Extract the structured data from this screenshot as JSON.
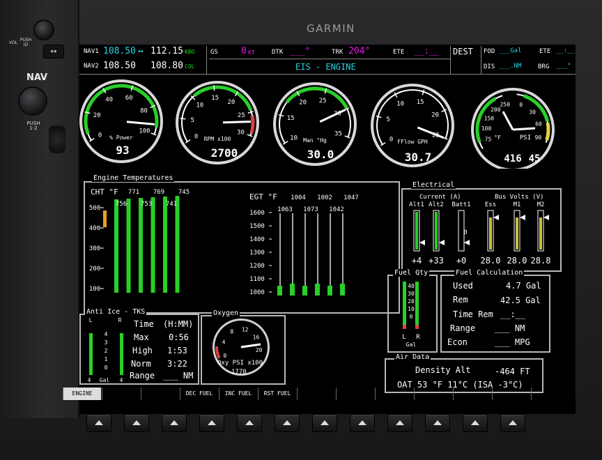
{
  "brand": "GARMIN",
  "bezel": {
    "vol_label": "VOL",
    "push_id_label": "PUSH\nID",
    "nav_label": "NAV",
    "push12_label": "PUSH\n1-2",
    "swap_icon": "swap-arrows-icon"
  },
  "nav": {
    "nav1_label": "NAV1",
    "nav1_active": "108.50",
    "nav1_standby": "112.15",
    "nav1_ident": "KBO",
    "nav2_label": "NAV2",
    "nav2_active": "108.50",
    "nav2_standby": "108.80",
    "nav2_ident": "COL"
  },
  "top": {
    "gs_label": "GS",
    "gs_value": "0",
    "gs_unit": "KT",
    "dtk_label": "DTK",
    "dtk_value": "___°",
    "trk_label": "TRK",
    "trk_value": "204°",
    "ete_label": "ETE",
    "ete_value": "__:__",
    "dest_label": "DEST",
    "fod_label": "FOD",
    "fod_value": "___Gal",
    "ete2_label": "ETE",
    "ete2_value": "__:__",
    "dis_label": "DIS",
    "dis_value": "___.NM",
    "brg_label": "BRG",
    "brg_value": "___°"
  },
  "page_title": "EIS - ENGINE",
  "gauges": [
    {
      "id": "power",
      "label": "% Power",
      "value": "93",
      "ticks": [
        "0",
        "20",
        "40",
        "60",
        "80",
        "100"
      ],
      "level": 0.93
    },
    {
      "id": "rpm",
      "label": "RPM x100",
      "value": "2700",
      "ticks": [
        "0",
        "5",
        "10",
        "15",
        "20",
        "25",
        "30"
      ],
      "level": 0.9
    },
    {
      "id": "manp",
      "label": "Man \"Hg",
      "value": "30.0",
      "ticks": [
        "10",
        "15",
        "20",
        "25",
        "30",
        "35"
      ],
      "level": 0.8
    },
    {
      "id": "fflow",
      "label": "FFlow GPH",
      "value": "30.7",
      "ticks": [
        "0",
        "5",
        "10",
        "15",
        "20",
        "25"
      ],
      "level": 1.0
    },
    {
      "id": "oil",
      "label_left": "°F",
      "label_right": "PSI",
      "value_left": "416",
      "value_right": "45",
      "ticks_left": [
        "75",
        "100",
        "150",
        "200",
        "250"
      ],
      "ticks_right": [
        "0",
        "30",
        "60",
        "90"
      ]
    }
  ],
  "engine_temps": {
    "title": "Engine Temperatures",
    "cht_label": "CHT °F",
    "cht_scale": [
      "500",
      "400",
      "300",
      "200",
      "100"
    ],
    "cht_values_top": [
      "771",
      "769",
      "745"
    ],
    "cht_values_bottom": [
      "756",
      "753",
      "741"
    ],
    "egt_label": "EGT °F",
    "egt_values_top": [
      "1004",
      "1002",
      "1047"
    ],
    "egt_values_bottom": [
      "1063",
      "1073",
      "1042"
    ],
    "egt_scale": [
      "1600",
      "1500",
      "1400",
      "1300",
      "1200",
      "1100",
      "1000"
    ]
  },
  "electrical": {
    "title": "Electrical",
    "current_label": "Current (A)",
    "bus_label": "Bus Volts (V)",
    "cols": [
      "Alt1",
      "Alt2",
      "Batt1",
      "Ess",
      "M1",
      "M2"
    ],
    "batt_zero": "0",
    "values": [
      "+4",
      "+33",
      "+0",
      "28.0",
      "28.0",
      "28.8"
    ]
  },
  "fuel_qty": {
    "title": "Fuel Qty",
    "scale": [
      "40",
      "30",
      "20",
      "10",
      "0"
    ],
    "left": "L",
    "right": "R",
    "unit": "Gal"
  },
  "fuel_calc": {
    "title": "Fuel Calculation",
    "used_label": "Used",
    "used_value": "4.7 Gal",
    "rem_label": "Rem",
    "rem_value": "42.5 Gal",
    "time_rem_label": "Time Rem",
    "time_rem_value": "__:__",
    "range_label": "Range",
    "range_value": "___ NM",
    "econ_label": "Econ",
    "econ_value": "___ MPG"
  },
  "anti_ice": {
    "title": "Anti Ice - TKS",
    "l": "L",
    "r": "R",
    "scale": [
      "4",
      "3",
      "2",
      "1",
      "0"
    ],
    "time_label": "Time",
    "time_unit": "(H:MM)",
    "max_label": "Max",
    "max_value": "0:56",
    "high_label": "High",
    "high_value": "1:53",
    "norm_label": "Norm",
    "norm_value": "3:22",
    "range_label": "Range",
    "range_value": "___ NM",
    "bottom_left": "4",
    "bottom_unit": "Gal",
    "bottom_right": "4"
  },
  "oxygen": {
    "title": "Oxygen",
    "ticks": [
      "0",
      "4",
      "8",
      "12",
      "16",
      "20"
    ],
    "label": "Oxy PSI x100",
    "value": "1770"
  },
  "air_data": {
    "title": "Air Data",
    "density_label": "Density Alt",
    "density_value": "-464 FT",
    "oat_text": "OAT 53 °F  11°C (ISA -3°C)"
  },
  "softkeys": [
    "ENGINE",
    "",
    "",
    "DEC FUEL",
    "INC FUEL",
    "RST FUEL",
    "",
    "",
    "",
    "",
    "",
    "",
    ""
  ],
  "colors": {
    "cyan": "#2ad4e6",
    "magenta": "#e020e0",
    "green": "#28d028",
    "bg": "#000000"
  }
}
